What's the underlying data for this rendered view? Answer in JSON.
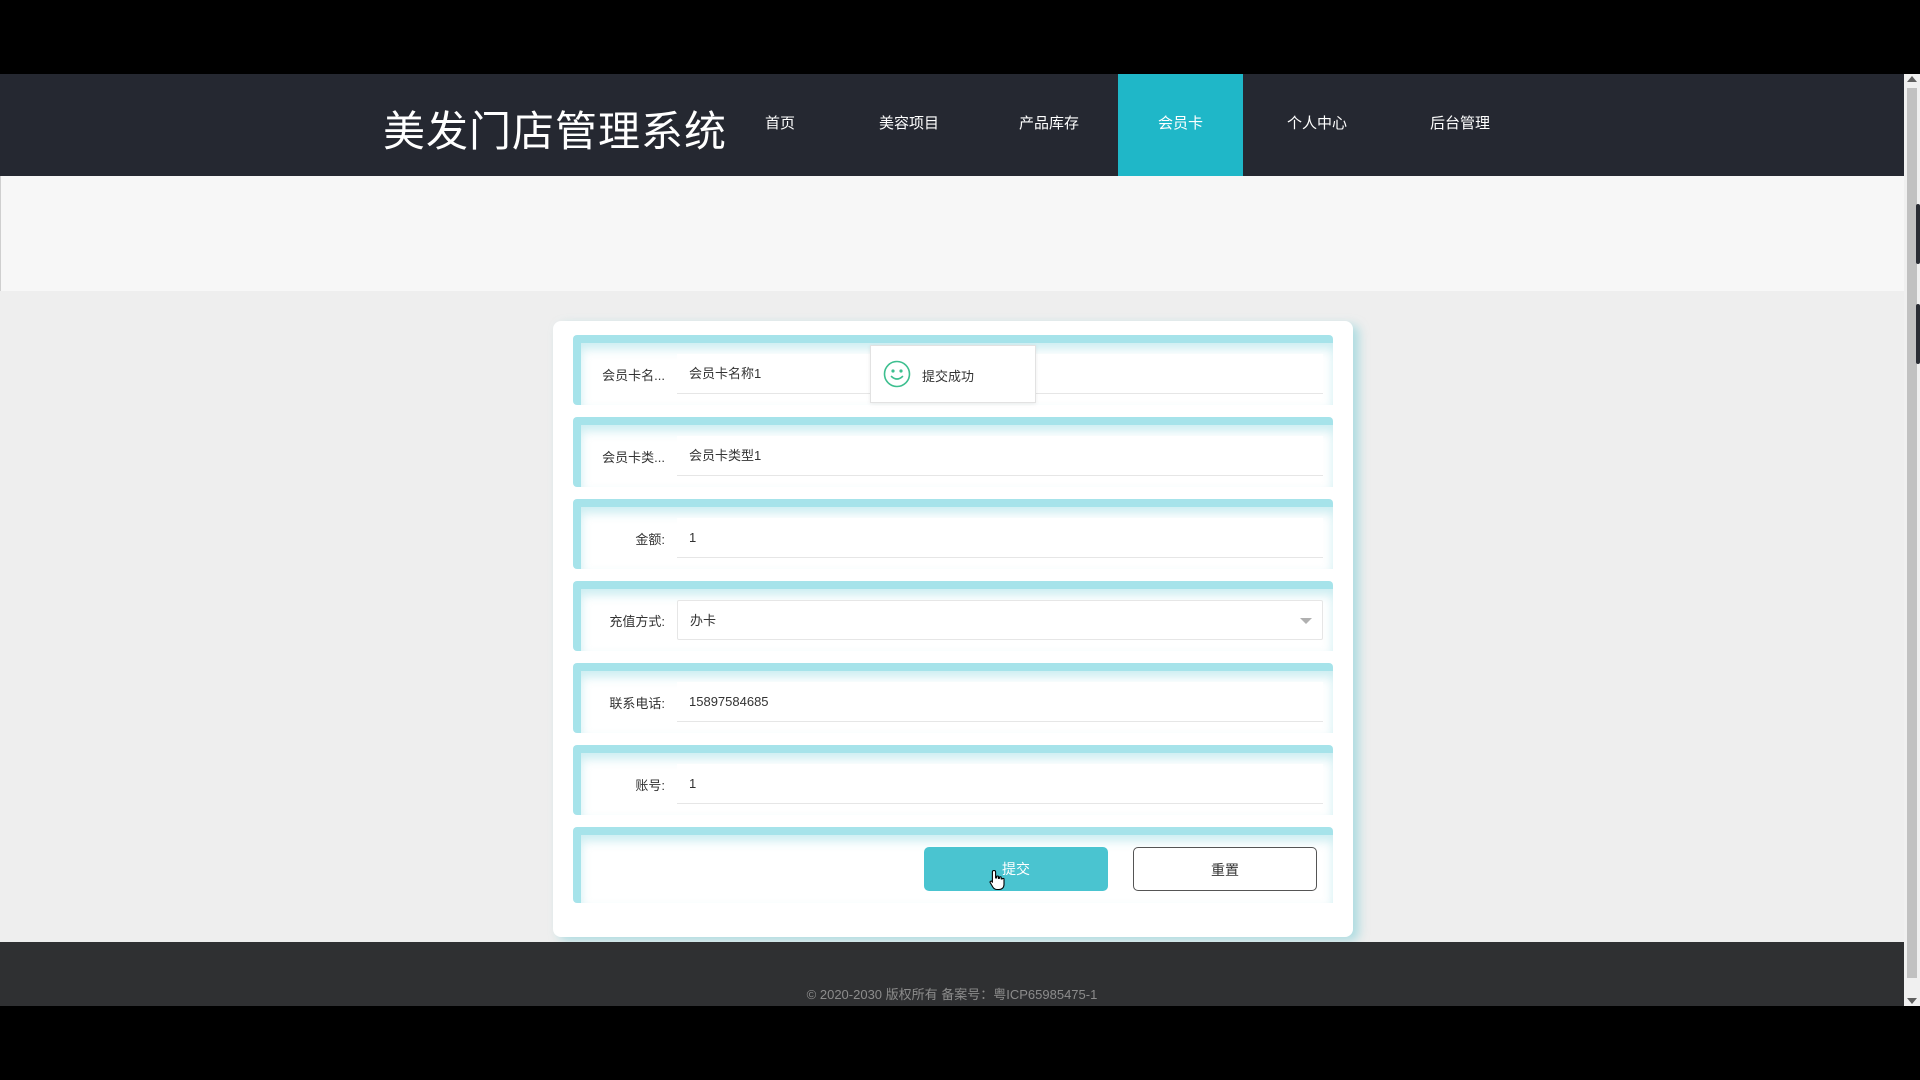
{
  "app": {
    "title": "美发门店管理系统"
  },
  "nav": {
    "items": [
      {
        "label": "首页",
        "active": false
      },
      {
        "label": "美容项目",
        "active": false
      },
      {
        "label": "产品库存",
        "active": false
      },
      {
        "label": "会员卡",
        "active": true
      },
      {
        "label": "个人中心",
        "active": false
      },
      {
        "label": "后台管理",
        "active": false
      }
    ]
  },
  "form": {
    "fields": [
      {
        "label": "会员卡名...",
        "value": "会员卡名称1",
        "type": "text"
      },
      {
        "label": "会员卡类...",
        "value": "会员卡类型1",
        "type": "text"
      },
      {
        "label": "金额:",
        "value": "1",
        "type": "text"
      },
      {
        "label": "充值方式:",
        "value": "办卡",
        "type": "select"
      },
      {
        "label": "联系电话:",
        "value": "15897584685",
        "type": "text"
      },
      {
        "label": "账号:",
        "value": "1",
        "type": "text"
      }
    ],
    "submit_label": "提交",
    "reset_label": "重置"
  },
  "toast": {
    "message": "提交成功",
    "icon": "smile-icon"
  },
  "footer": {
    "text": "© 2020-2030 版权所有 备案号：粤ICP65985475-1"
  },
  "colors": {
    "nav_bg": "#252831",
    "accent": "#1fb7c8",
    "submit_bg": "#4ac4d0",
    "row_border": "#a6e3ea",
    "footer_bg": "#2f3032"
  }
}
